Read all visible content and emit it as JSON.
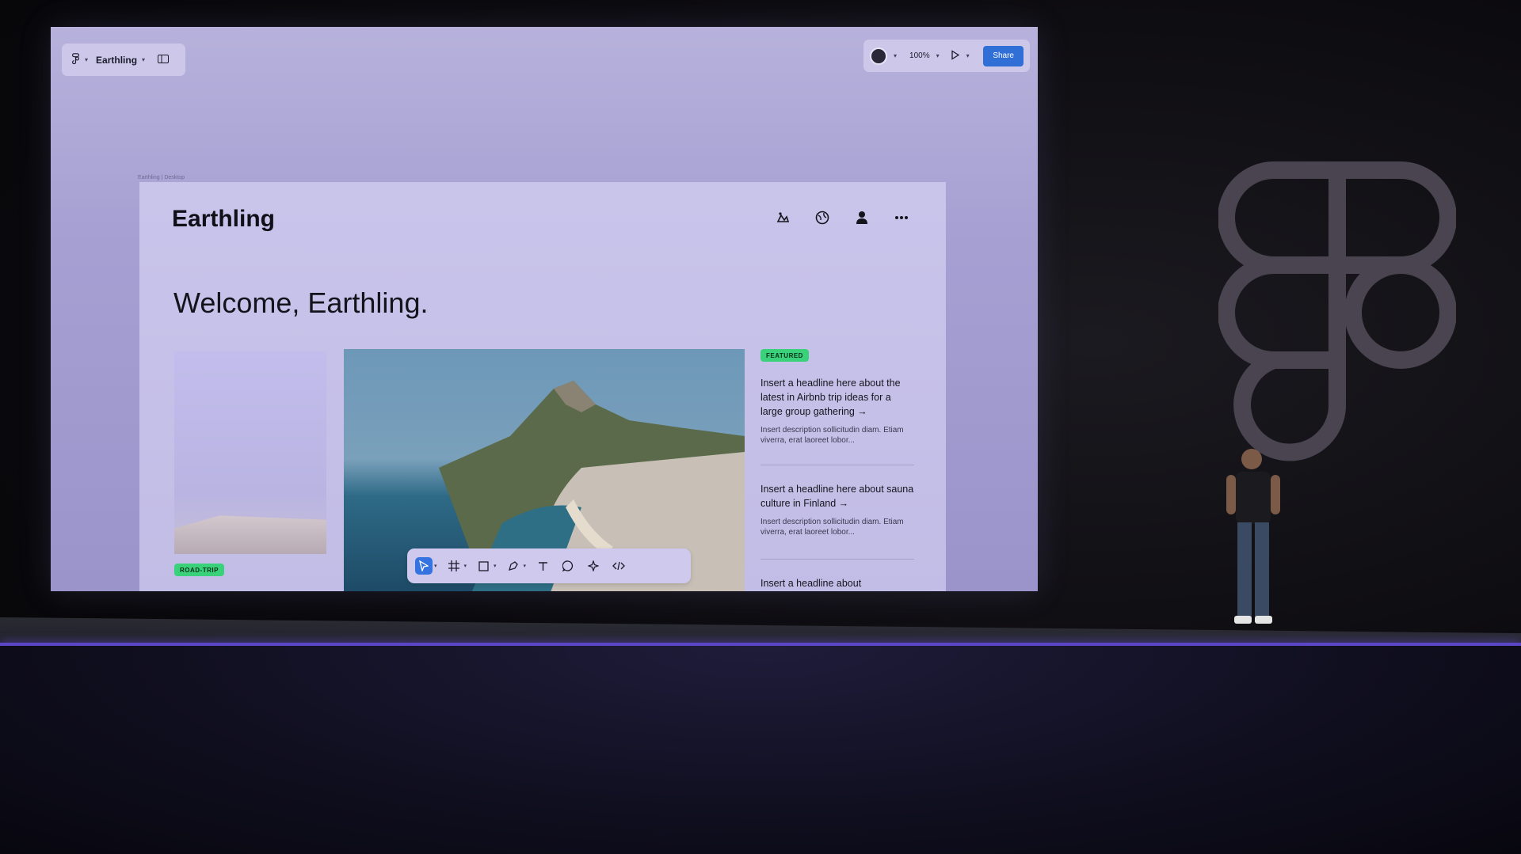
{
  "figma_toolbar": {
    "file_name": "Earthling",
    "zoom": "100%",
    "share_label": "Share"
  },
  "frame": {
    "label": "Earthling | Desktop"
  },
  "site": {
    "brand": "Earthling",
    "welcome": "Welcome, Earthling.",
    "tag_roadtrip": "ROAD-TRIP",
    "tag_featured": "FEATURED",
    "articles": [
      {
        "headline": "Insert a headline here about the latest in Airbnb trip ideas for a large group gathering →",
        "description": "Insert description sollicitudin diam. Etiam viverra, erat laoreet lobor..."
      },
      {
        "headline": "Insert a headline here about sauna culture in Finland →",
        "description": "Insert description sollicitudin diam. Etiam viverra, erat laoreet lobor..."
      },
      {
        "headline": "Insert a headline about",
        "description": ""
      }
    ]
  },
  "tools": [
    "move-tool",
    "frame-tool",
    "shape-tool",
    "pen-tool",
    "text-tool",
    "comment-tool",
    "actions-tool",
    "dev-mode-tool"
  ],
  "colors": {
    "share": "#2f6fd6",
    "tag": "#39d27a",
    "active_tool": "#3573e0",
    "stage_edge": "#5b46c7"
  }
}
